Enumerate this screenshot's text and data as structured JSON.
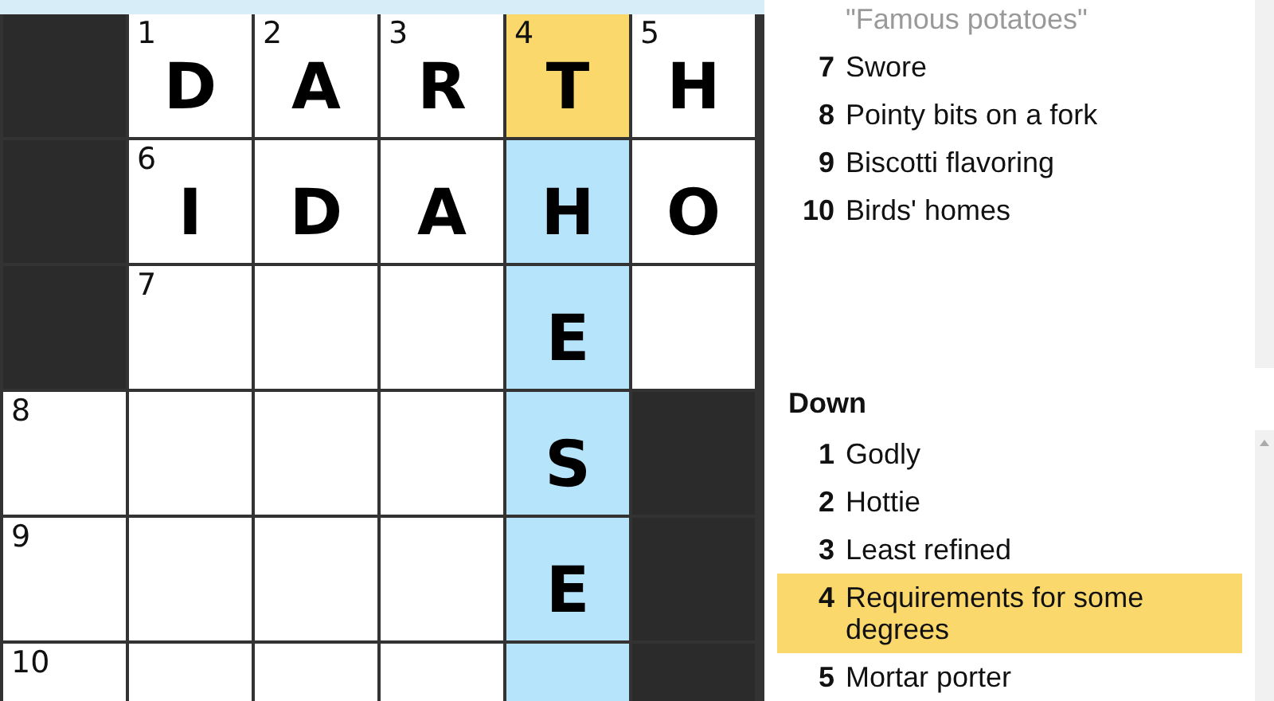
{
  "grid": {
    "rows": [
      [
        {
          "kind": "block"
        },
        {
          "kind": "cell",
          "number": "1",
          "letter": "D",
          "selected": false,
          "in_word": false
        },
        {
          "kind": "cell",
          "number": "2",
          "letter": "A",
          "selected": false,
          "in_word": false
        },
        {
          "kind": "cell",
          "number": "3",
          "letter": "R",
          "selected": false,
          "in_word": false
        },
        {
          "kind": "cell",
          "number": "4",
          "letter": "T",
          "selected": true
        },
        {
          "kind": "cell",
          "number": "5",
          "letter": "H",
          "selected": false,
          "in_word": false
        }
      ],
      [
        {
          "kind": "block"
        },
        {
          "kind": "cell",
          "number": "6",
          "letter": "I",
          "selected": false,
          "in_word": false
        },
        {
          "kind": "cell",
          "letter": "D",
          "selected": false,
          "in_word": false
        },
        {
          "kind": "cell",
          "letter": "A",
          "selected": false,
          "in_word": false
        },
        {
          "kind": "cell",
          "letter": "H",
          "selected": false,
          "in_word": true
        },
        {
          "kind": "cell",
          "letter": "O",
          "selected": false,
          "in_word": false
        }
      ],
      [
        {
          "kind": "block"
        },
        {
          "kind": "cell",
          "number": "7",
          "selected": false,
          "in_word": false
        },
        {
          "kind": "cell",
          "selected": false,
          "in_word": false
        },
        {
          "kind": "cell",
          "selected": false,
          "in_word": false
        },
        {
          "kind": "cell",
          "letter": "E",
          "selected": false,
          "in_word": true
        },
        {
          "kind": "cell",
          "selected": false,
          "in_word": false
        }
      ],
      [
        {
          "kind": "cell",
          "number": "8",
          "selected": false,
          "in_word": false
        },
        {
          "kind": "cell",
          "selected": false,
          "in_word": false
        },
        {
          "kind": "cell",
          "selected": false,
          "in_word": false
        },
        {
          "kind": "cell",
          "selected": false,
          "in_word": false
        },
        {
          "kind": "cell",
          "letter": "S",
          "selected": false,
          "in_word": true
        },
        {
          "kind": "block"
        }
      ],
      [
        {
          "kind": "cell",
          "number": "9",
          "selected": false,
          "in_word": false
        },
        {
          "kind": "cell",
          "selected": false,
          "in_word": false
        },
        {
          "kind": "cell",
          "selected": false,
          "in_word": false
        },
        {
          "kind": "cell",
          "selected": false,
          "in_word": false
        },
        {
          "kind": "cell",
          "letter": "E",
          "selected": false,
          "in_word": true
        },
        {
          "kind": "block"
        }
      ],
      [
        {
          "kind": "cell",
          "number": "10",
          "selected": false,
          "in_word": false
        },
        {
          "kind": "cell",
          "selected": false,
          "in_word": false
        },
        {
          "kind": "cell",
          "selected": false,
          "in_word": false
        },
        {
          "kind": "cell",
          "selected": false,
          "in_word": false
        },
        {
          "kind": "cell",
          "selected": false,
          "in_word": true
        },
        {
          "kind": "block"
        }
      ]
    ]
  },
  "across": {
    "clues": [
      {
        "text": "\"Famous potatoes\"",
        "completed": true,
        "selected": false
      },
      {
        "number": "7",
        "text": "Swore",
        "completed": false,
        "selected": false
      },
      {
        "number": "8",
        "text": "Pointy bits on a fork",
        "completed": false,
        "selected": false
      },
      {
        "number": "9",
        "text": "Biscotti flavoring",
        "completed": false,
        "selected": false
      },
      {
        "number": "10",
        "text": "Birds' homes",
        "completed": false,
        "selected": false
      }
    ]
  },
  "down": {
    "title": "Down",
    "clues": [
      {
        "number": "1",
        "text": "Godly",
        "completed": false,
        "selected": false
      },
      {
        "number": "2",
        "text": "Hottie",
        "completed": false,
        "selected": false
      },
      {
        "number": "3",
        "text": "Least refined",
        "completed": false,
        "selected": false
      },
      {
        "number": "4",
        "text": "Requirements for some degrees",
        "completed": false,
        "selected": true
      },
      {
        "number": "5",
        "text": "Mortar porter",
        "completed": false,
        "selected": false
      }
    ]
  }
}
